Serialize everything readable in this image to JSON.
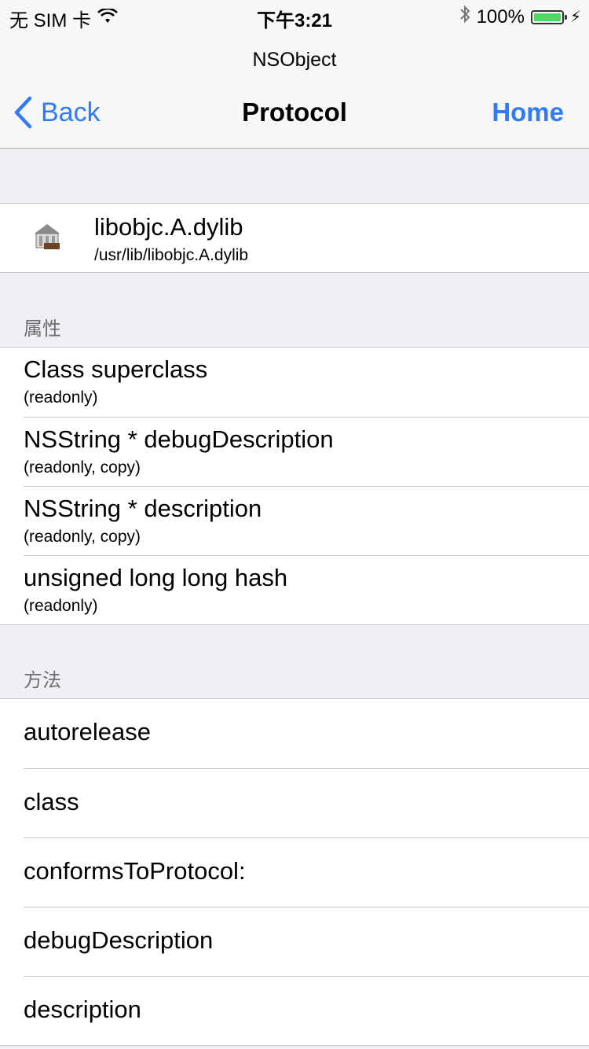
{
  "status_bar": {
    "carrier": "无 SIM 卡",
    "time": "下午3:21",
    "battery_percent": "100%",
    "battery_level": 1.0
  },
  "nav": {
    "prompt": "NSObject",
    "back_label": "Back",
    "title": "Protocol",
    "home_label": "Home",
    "accent_color": "#2f7cf6"
  },
  "library": {
    "name": "libobjc.A.dylib",
    "path": "/usr/lib/libobjc.A.dylib",
    "icon": "library-icon"
  },
  "properties": {
    "header": "属性",
    "items": [
      {
        "title": "Class superclass",
        "attrs": "(readonly)"
      },
      {
        "title": "NSString * debugDescription",
        "attrs": "(readonly, copy)"
      },
      {
        "title": "NSString * description",
        "attrs": "(readonly, copy)"
      },
      {
        "title": "unsigned long long hash",
        "attrs": "(readonly)"
      }
    ]
  },
  "methods": {
    "header": "方法",
    "items": [
      {
        "title": "autorelease"
      },
      {
        "title": "class"
      },
      {
        "title": "conformsToProtocol:"
      },
      {
        "title": "debugDescription"
      },
      {
        "title": "description"
      }
    ]
  }
}
